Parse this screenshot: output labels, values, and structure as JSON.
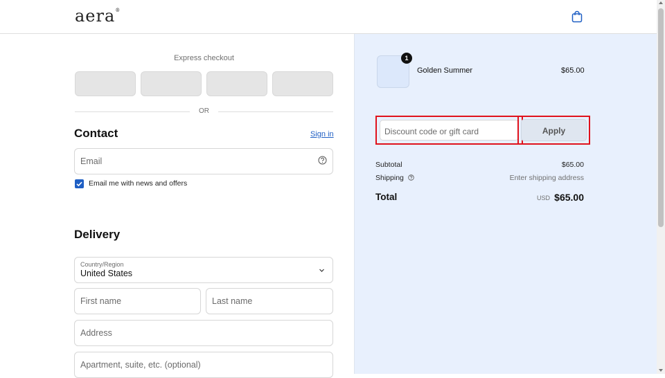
{
  "header": {
    "logo_text": "aera",
    "logo_mark": "®",
    "cart_icon": "shopping-bag-icon"
  },
  "express": {
    "title": "Express checkout",
    "buttons": [
      "",
      "",
      "",
      ""
    ],
    "divider_text": "OR"
  },
  "contact": {
    "title": "Contact",
    "signin_label": "Sign in",
    "email_placeholder": "Email",
    "newsletter_label": "Email me with news and offers",
    "newsletter_checked": true
  },
  "delivery": {
    "title": "Delivery",
    "country_label": "Country/Region",
    "country_value": "United States",
    "first_name_placeholder": "First name",
    "last_name_placeholder": "Last name",
    "address_placeholder": "Address",
    "apartment_placeholder": "Apartment, suite, etc. (optional)"
  },
  "order": {
    "item": {
      "name": "Golden Summer",
      "price": "$65.00",
      "quantity": "1"
    },
    "discount_placeholder": "Discount code or gift card",
    "apply_label": "Apply",
    "subtotal_label": "Subtotal",
    "subtotal_value": "$65.00",
    "shipping_label": "Shipping",
    "shipping_value": "Enter shipping address",
    "total_label": "Total",
    "total_currency": "USD",
    "total_value": "$65.00"
  },
  "colors": {
    "accent": "#1f5fc4",
    "summary_bg": "#e8f0fd",
    "highlight": "#e0111b"
  }
}
